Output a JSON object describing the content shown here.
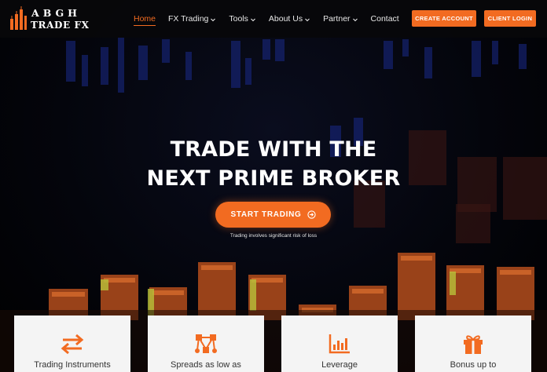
{
  "brand": {
    "name_top": "ABGH",
    "name_bottom": "TRADE FX",
    "accent": "#f26b21"
  },
  "nav": {
    "items": [
      {
        "label": "Home",
        "active": true,
        "dropdown": false
      },
      {
        "label": "FX Trading",
        "active": false,
        "dropdown": true
      },
      {
        "label": "Tools",
        "active": false,
        "dropdown": true
      },
      {
        "label": "About Us",
        "active": false,
        "dropdown": true
      },
      {
        "label": "Partner",
        "active": false,
        "dropdown": true
      },
      {
        "label": "Contact",
        "active": false,
        "dropdown": false
      }
    ],
    "create_account": "CREATE ACCOUNT",
    "client_login": "CLIENT LOGIN"
  },
  "hero": {
    "headline_line1": "TRADE WITH THE",
    "headline_line2": "NEXT PRIME BROKER",
    "cta_label": "START TRADING",
    "cta_icon": "arrow-circle-right-icon",
    "risk_note": "Trading involves significant risk of loss"
  },
  "cards": [
    {
      "label": "Trading Instruments",
      "icon": "swap-arrows-icon"
    },
    {
      "label": "Spreads as low as",
      "icon": "network-nodes-icon"
    },
    {
      "label": "Leverage",
      "icon": "bar-chart-icon"
    },
    {
      "label": "Bonus up to",
      "icon": "gift-icon"
    }
  ]
}
